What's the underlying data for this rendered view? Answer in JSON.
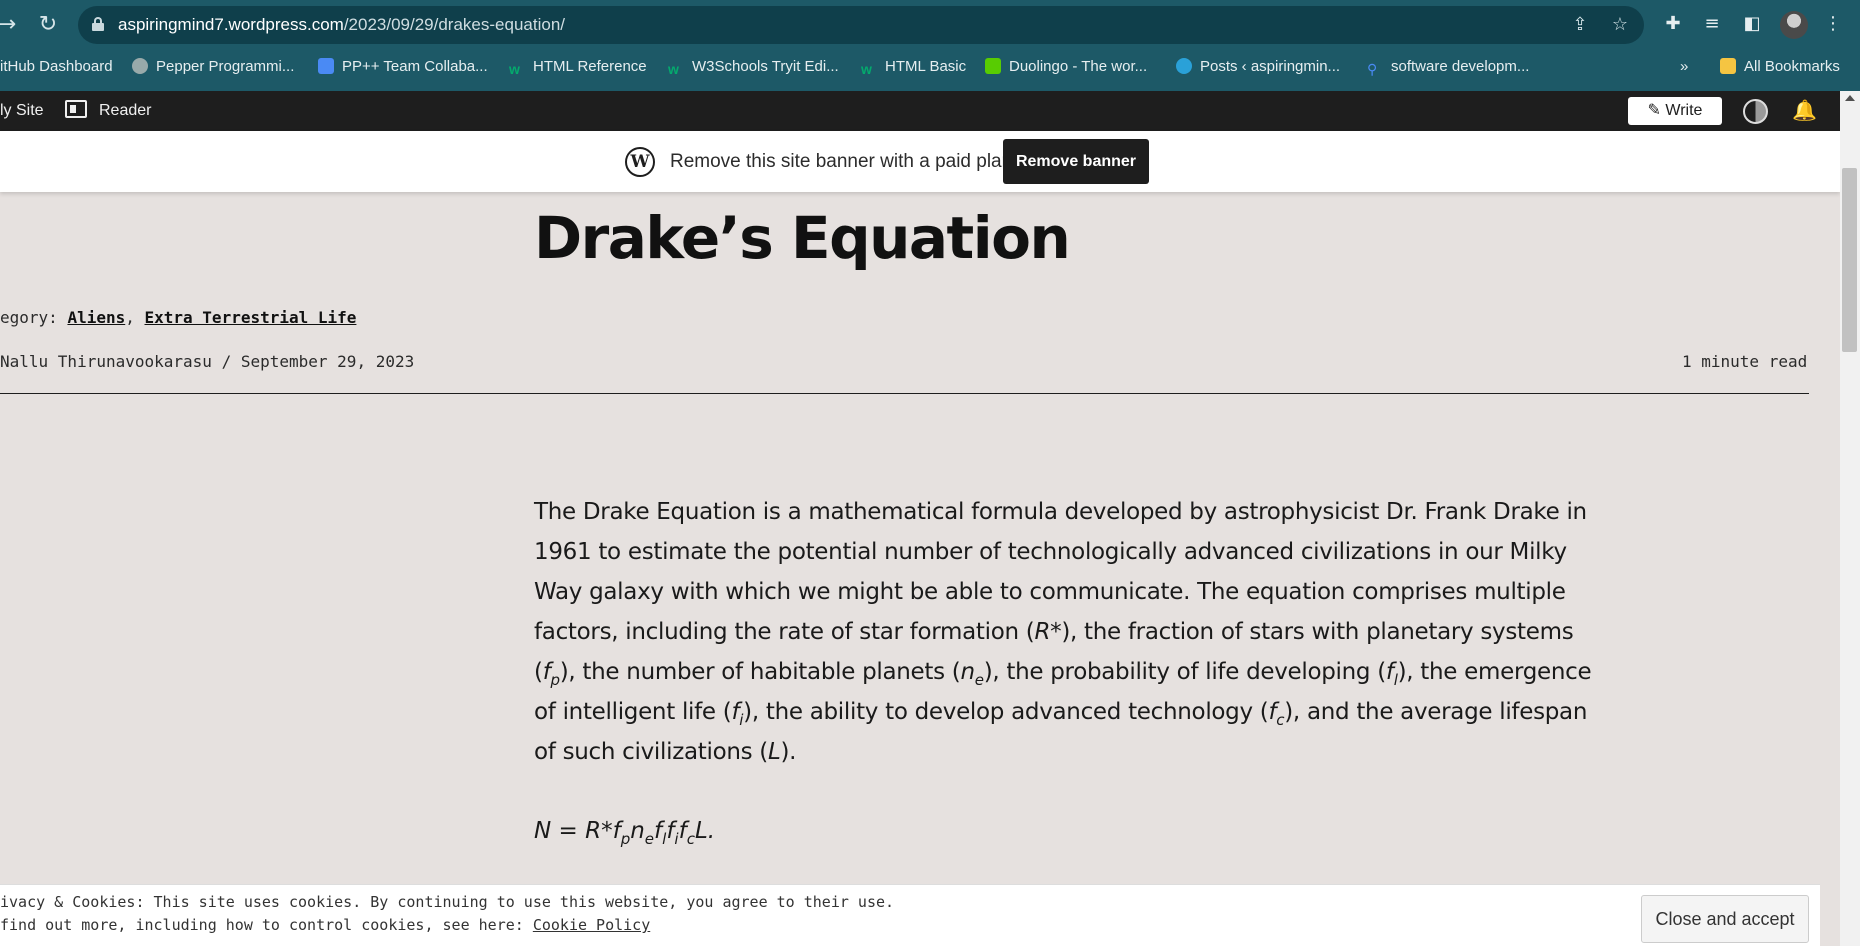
{
  "browser": {
    "url_host": "aspiringmind7.wordpress.com",
    "url_path": "/2023/09/29/drakes-equation/",
    "bookmarks": [
      {
        "label": "itHub Dashboard",
        "icon": "github-icon"
      },
      {
        "label": "Pepper Programmi...",
        "icon": "compass-icon"
      },
      {
        "label": "PP++ Team Collaba...",
        "icon": "docs-icon"
      },
      {
        "label": "HTML Reference",
        "icon": "w3schools-icon"
      },
      {
        "label": "W3Schools Tryit Edi...",
        "icon": "w3schools-icon"
      },
      {
        "label": "HTML Basic",
        "icon": "w3schools-icon"
      },
      {
        "label": "Duolingo - The wor...",
        "icon": "duolingo-icon"
      },
      {
        "label": "Posts ‹ aspiringmin...",
        "icon": "wordpress-icon"
      },
      {
        "label": "software developm...",
        "icon": "search-icon"
      }
    ],
    "overflow_label": "»",
    "all_bookmarks": "All Bookmarks"
  },
  "adminbar": {
    "my_site": "ly Site",
    "reader": "Reader",
    "write": "Write"
  },
  "banner": {
    "text": "Remove this site banner with a paid plan",
    "button": "Remove banner"
  },
  "post": {
    "title": "Drake’s Equation",
    "category_label": "egory:",
    "categories": [
      "Aliens",
      "Extra Terrestrial Life"
    ],
    "author": "Nallu Thirunavookarasu",
    "separator": "/",
    "date": "September 29, 2023",
    "read_time": "1 minute read",
    "para": {
      "s1": "The Drake Equation is a mathematical formula developed by astrophysicist Dr. Frank Drake in 1961 to estimate the potential number of technologically advanced civilizations in our Milky Way galaxy with which we might be able to communicate. The equation comprises multiple factors, including the rate of star formation (",
      "s2": "), the fraction of stars with planetary systems (",
      "s3": "), the number of habitable planets (",
      "s4": "), the probability of life developing (",
      "s5": "), the emergence of intelligent life (",
      "s6": "), the ability to develop advanced technology (",
      "s7": "), and the average lifespan of such civilizations (",
      "s8": ")."
    }
  },
  "cookie": {
    "line1": "ivacy & Cookies: This site uses cookies. By continuing to use this website, you agree to their use.",
    "line2": " find out more, including how to control cookies, see here:",
    "link": "Cookie Policy",
    "button": "Close and accept"
  }
}
